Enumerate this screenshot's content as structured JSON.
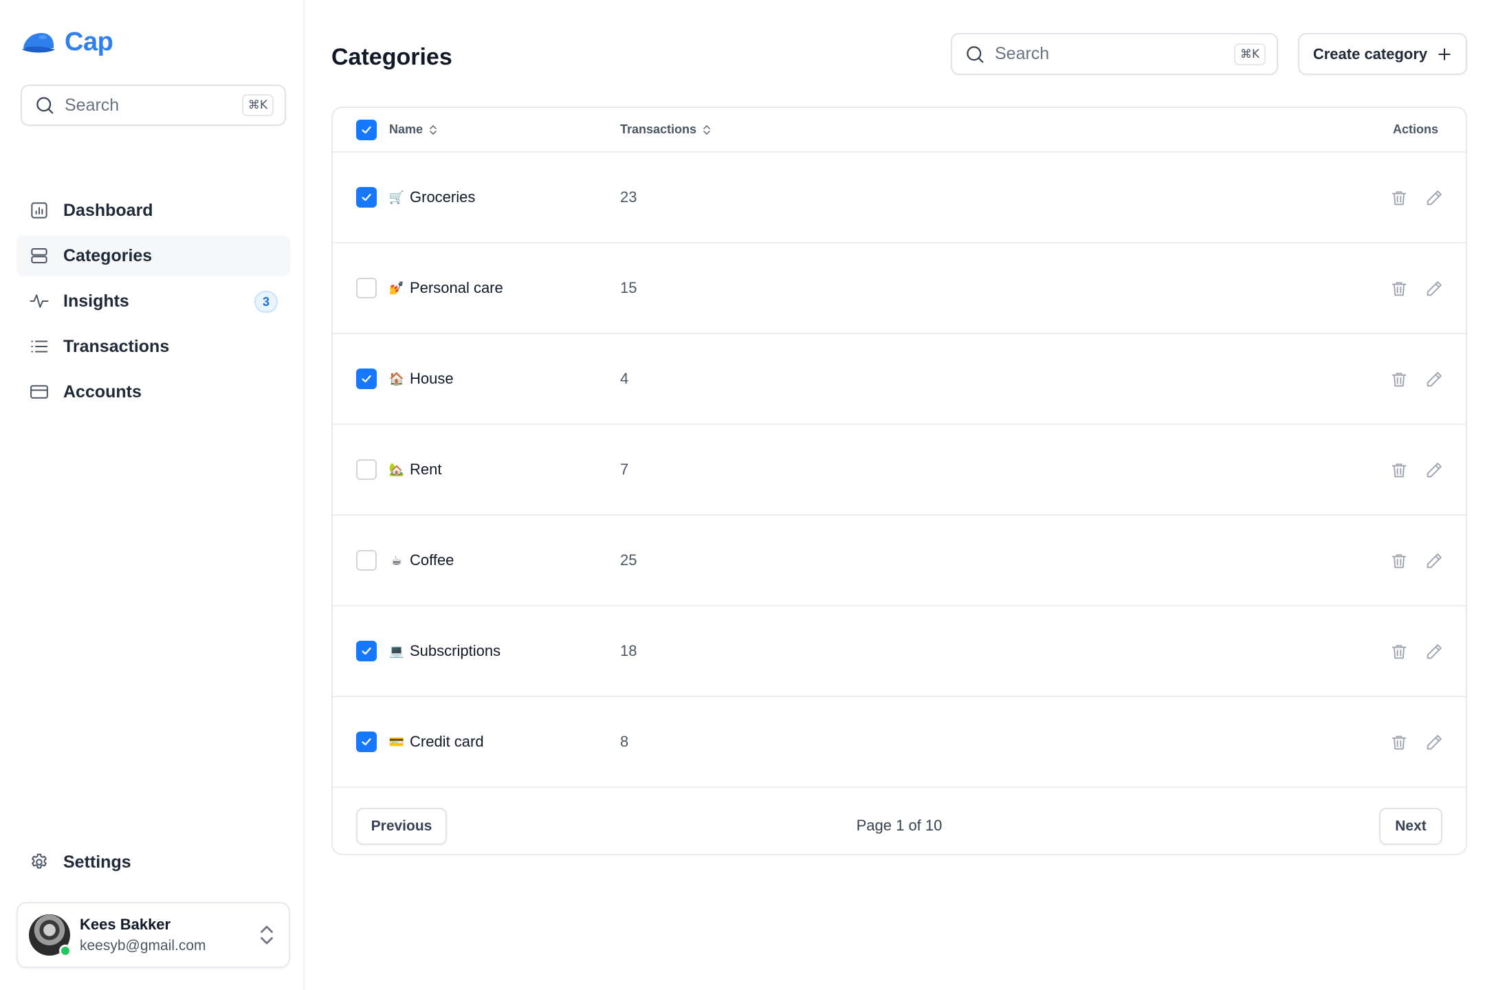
{
  "app": {
    "name": "Cap"
  },
  "sidebar": {
    "search": {
      "placeholder": "Search",
      "shortcut": "⌘K"
    },
    "items": [
      {
        "label": "Dashboard",
        "icon": "chart-icon"
      },
      {
        "label": "Categories",
        "icon": "stack-icon",
        "active": true
      },
      {
        "label": "Insights",
        "icon": "activity-icon",
        "badge": "3"
      },
      {
        "label": "Transactions",
        "icon": "list-icon"
      },
      {
        "label": "Accounts",
        "icon": "card-icon"
      }
    ],
    "settings": {
      "label": "Settings",
      "icon": "gear-icon"
    },
    "user": {
      "name": "Kees Bakker",
      "email": "keesyb@gmail.com",
      "status": "online"
    }
  },
  "header": {
    "title": "Categories",
    "search": {
      "placeholder": "Search",
      "shortcut": "⌘K"
    },
    "create_label": "Create category"
  },
  "table": {
    "columns": {
      "name": "Name",
      "transactions": "Transactions",
      "actions": "Actions"
    },
    "select_all_checked": true,
    "rows": [
      {
        "emoji": "🛒",
        "name": "Groceries",
        "count": "23",
        "checked": true
      },
      {
        "emoji": "💅",
        "name": "Personal care",
        "count": "15",
        "checked": false
      },
      {
        "emoji": "🏠",
        "name": "House",
        "count": "4",
        "checked": true
      },
      {
        "emoji": "🏡",
        "name": "Rent",
        "count": "7",
        "checked": false
      },
      {
        "emoji": "☕",
        "name": "Coffee",
        "count": "25",
        "checked": false
      },
      {
        "emoji": "💻",
        "name": "Subscriptions",
        "count": "18",
        "checked": true
      },
      {
        "emoji": "💳",
        "name": "Credit card",
        "count": "8",
        "checked": true
      }
    ]
  },
  "pagination": {
    "previous": "Previous",
    "page_info": "Page 1 of 10",
    "next": "Next"
  },
  "colors": {
    "accent": "#1677ff",
    "brand": "#2f80ed",
    "online": "#22c55e"
  }
}
